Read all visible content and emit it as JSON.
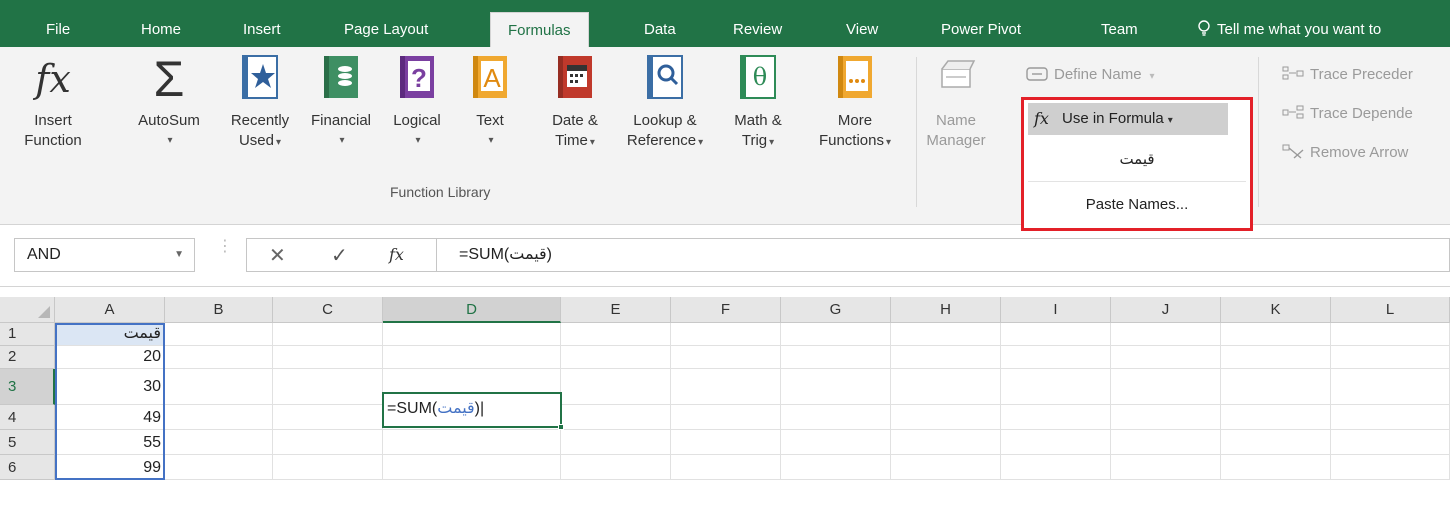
{
  "tabs": [
    {
      "label": "File"
    },
    {
      "label": "Home"
    },
    {
      "label": "Insert"
    },
    {
      "label": "Page Layout"
    },
    {
      "label": "Formulas"
    },
    {
      "label": "Data"
    },
    {
      "label": "Review"
    },
    {
      "label": "View"
    },
    {
      "label": "Power Pivot"
    },
    {
      "label": "Team"
    }
  ],
  "tell_me": "Tell me what you want to",
  "ribbon": {
    "insert_function": {
      "line1": "Insert",
      "line2": "Function",
      "icon": "fx-icon"
    },
    "autosum": {
      "line1": "AutoSum",
      "line2": "",
      "icon": "sigma-icon"
    },
    "recently_used": {
      "line1": "Recently",
      "line2": "Used",
      "icon": "star-book-icon"
    },
    "financial": {
      "line1": "Financial",
      "line2": "",
      "icon": "coins-book-icon"
    },
    "logical": {
      "line1": "Logical",
      "line2": "",
      "icon": "question-book-icon"
    },
    "text": {
      "line1": "Text",
      "line2": "",
      "icon": "text-book-icon"
    },
    "date_time": {
      "line1": "Date &",
      "line2": "Time",
      "icon": "calendar-book-icon"
    },
    "lookup_reference": {
      "line1": "Lookup &",
      "line2": "Reference",
      "icon": "magnifier-book-icon"
    },
    "math_trig": {
      "line1": "Math &",
      "line2": "Trig",
      "icon": "theta-book-icon"
    },
    "more_functions": {
      "line1": "More",
      "line2": "Functions",
      "icon": "dots-book-icon"
    },
    "group_label": "Function Library",
    "name_manager": {
      "line1": "Name",
      "line2": "Manager"
    },
    "define_name": "Define Name",
    "use_in_formula": "Use in Formula",
    "trace_precedents": "Trace Preceder",
    "trace_dependents": "Trace Depende",
    "remove_arrows": "Remove Arrow"
  },
  "dropdown": {
    "items": [
      {
        "label": "قيمت"
      },
      {
        "label": "Paste Names..."
      }
    ]
  },
  "formula_bar": {
    "name_box": "AND",
    "formula": "=SUM(قيمت)"
  },
  "grid": {
    "columns": [
      "A",
      "B",
      "C",
      "D",
      "E",
      "F",
      "G",
      "H",
      "I",
      "J",
      "K",
      "L"
    ],
    "rows": [
      {
        "num": "1",
        "A": "قيمت"
      },
      {
        "num": "2",
        "A": "20"
      },
      {
        "num": "3",
        "A": "30"
      },
      {
        "num": "4",
        "A": "49"
      },
      {
        "num": "5",
        "A": "55"
      },
      {
        "num": "6",
        "A": "99"
      }
    ],
    "active_cell_text_prefix": "=SUM(",
    "active_cell_text_name": "قيمت",
    "active_cell_text_suffix": ")"
  },
  "colors": {
    "accent": "#217346",
    "highlight_border": "#e32028",
    "range_border": "#4472c4"
  }
}
